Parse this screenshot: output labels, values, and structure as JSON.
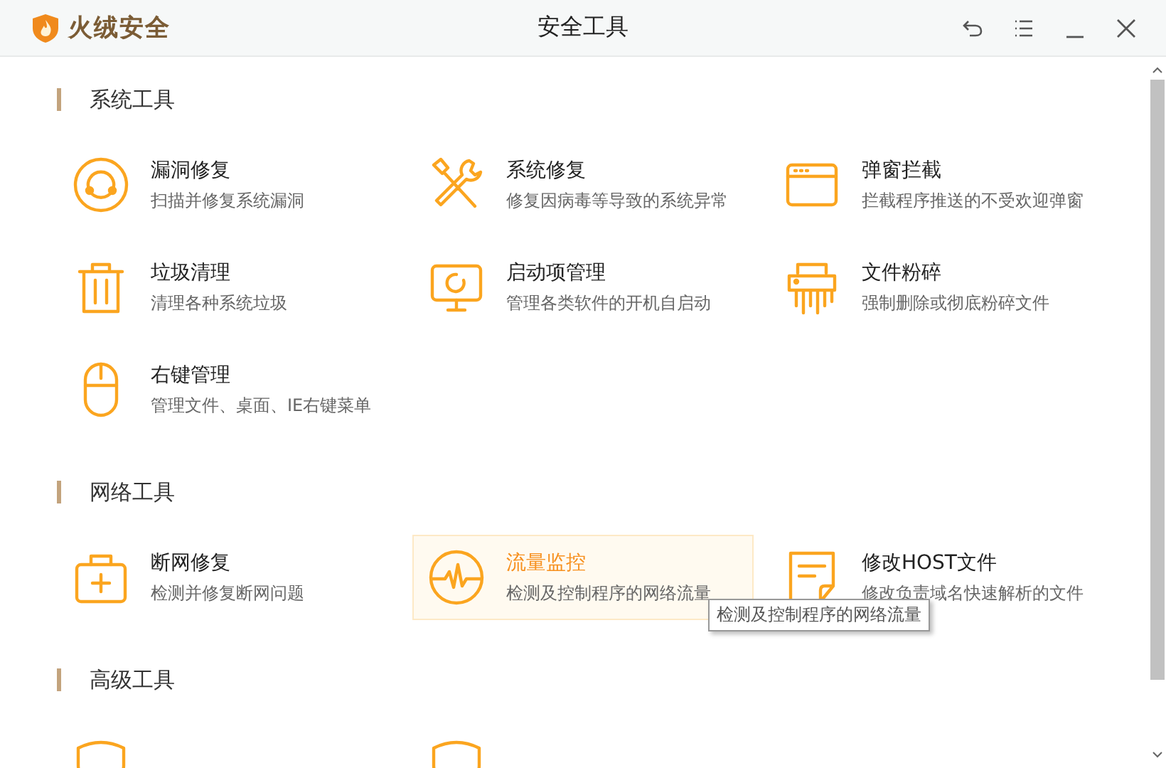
{
  "window": {
    "logo_text": "火绒安全",
    "title": "安全工具"
  },
  "sections": [
    {
      "title": "系统工具",
      "items": [
        {
          "name": "漏洞修复",
          "desc": "扫描并修复系统漏洞",
          "hovered": false
        },
        {
          "name": "系统修复",
          "desc": "修复因病毒等导致的系统异常",
          "hovered": false
        },
        {
          "name": "弹窗拦截",
          "desc": "拦截程序推送的不受欢迎弹窗",
          "hovered": false
        },
        {
          "name": "垃圾清理",
          "desc": "清理各种系统垃圾",
          "hovered": false
        },
        {
          "name": "启动项管理",
          "desc": "管理各类软件的开机自启动",
          "hovered": false
        },
        {
          "name": "文件粉碎",
          "desc": "强制删除或彻底粉碎文件",
          "hovered": false
        },
        {
          "name": "右键管理",
          "desc": "管理文件、桌面、IE右键菜单",
          "hovered": false
        }
      ]
    },
    {
      "title": "网络工具",
      "items": [
        {
          "name": "断网修复",
          "desc": "检测并修复断网问题",
          "hovered": false
        },
        {
          "name": "流量监控",
          "desc": "检测及控制程序的网络流量",
          "hovered": true
        },
        {
          "name": "修改HOST文件",
          "desc": "修改负责域名快速解析的文件",
          "hovered": false
        }
      ]
    },
    {
      "title": "高级工具",
      "items": [
        {
          "hovered": false
        },
        {
          "hovered": false
        }
      ]
    }
  ],
  "tooltip": {
    "text": "检测及控制程序的网络流量"
  }
}
